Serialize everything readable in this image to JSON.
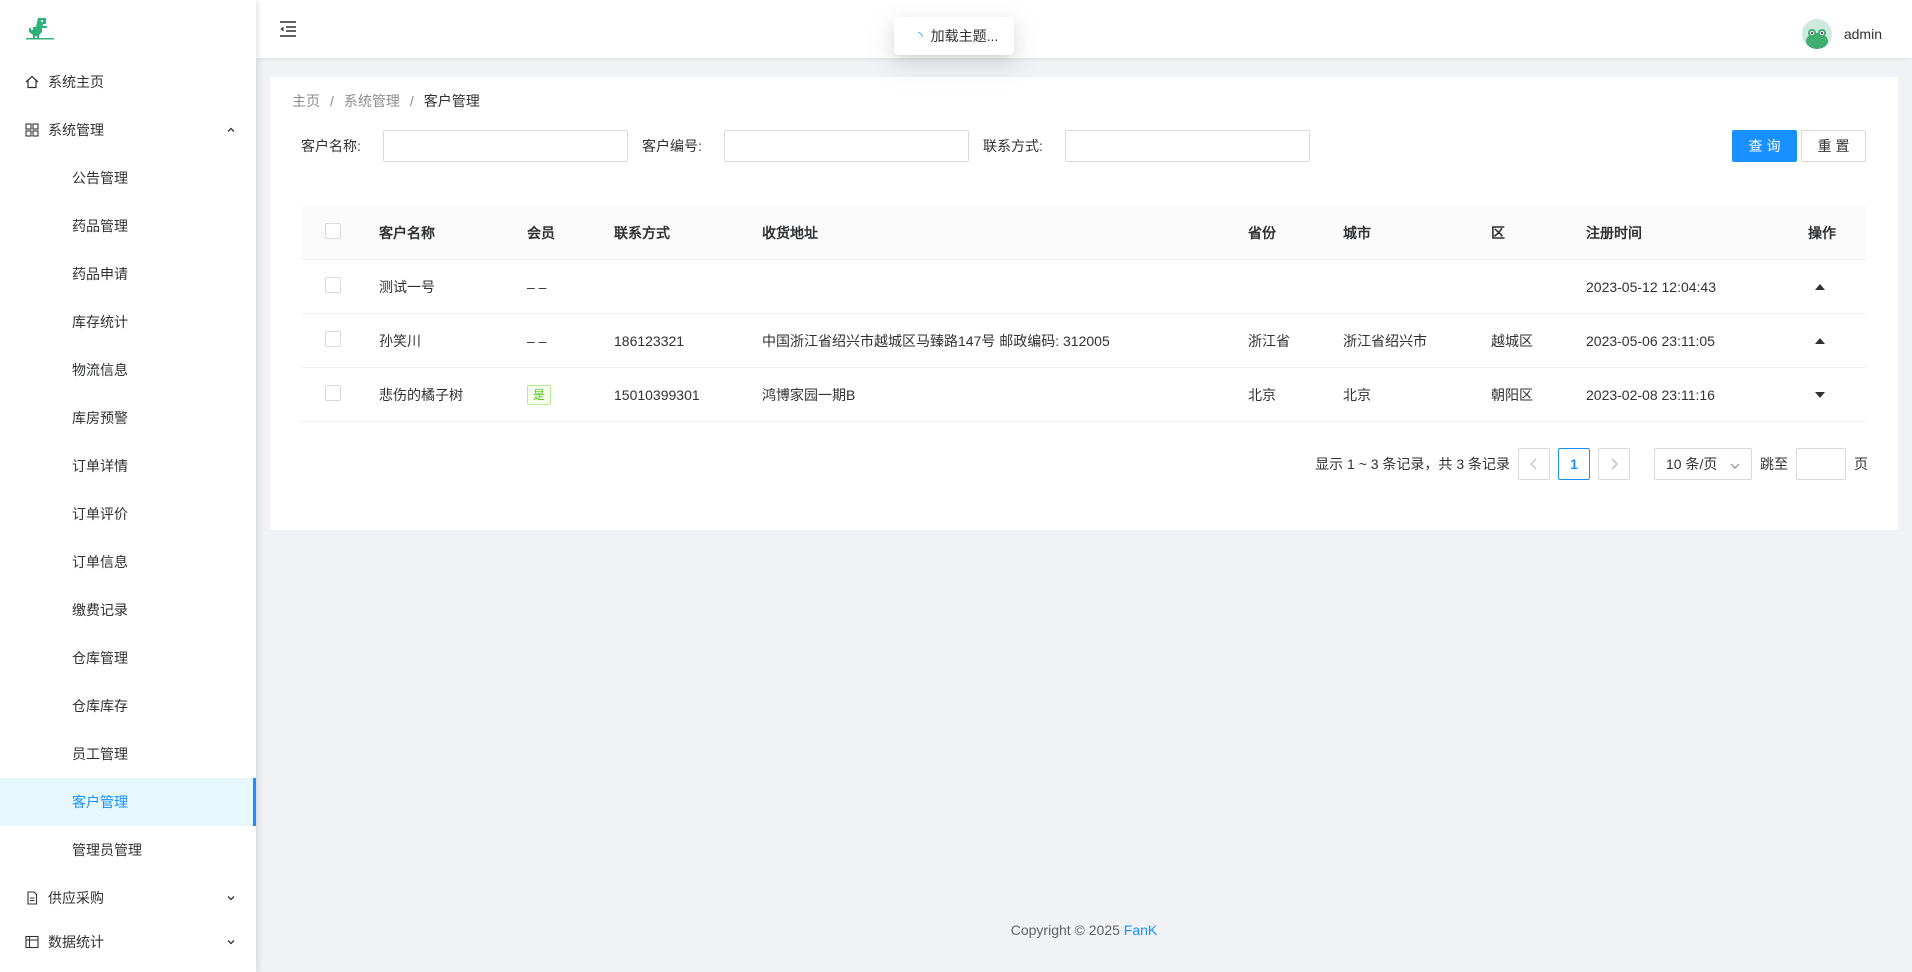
{
  "sidebar": {
    "items": [
      {
        "label": "系统主页"
      },
      {
        "label": "系统管理"
      },
      {
        "label": "供应采购"
      },
      {
        "label": "数据统计"
      }
    ],
    "sub_items": [
      {
        "label": "公告管理"
      },
      {
        "label": "药品管理"
      },
      {
        "label": "药品申请"
      },
      {
        "label": "库存统计"
      },
      {
        "label": "物流信息"
      },
      {
        "label": "库房预警"
      },
      {
        "label": "订单详情"
      },
      {
        "label": "订单评价"
      },
      {
        "label": "订单信息"
      },
      {
        "label": "缴费记录"
      },
      {
        "label": "仓库管理"
      },
      {
        "label": "仓库库存"
      },
      {
        "label": "员工管理"
      },
      {
        "label": "客户管理"
      },
      {
        "label": "管理员管理"
      }
    ]
  },
  "header": {
    "loading_text": "加载主题...",
    "user_name": "admin"
  },
  "breadcrumb": [
    "主页",
    "系统管理",
    "客户管理"
  ],
  "search": {
    "name_label": "客户名称:",
    "code_label": "客户编号:",
    "contact_label": "联系方式:",
    "query_button": "查询",
    "reset_button": "重置"
  },
  "table": {
    "headers": [
      "客户名称",
      "会员",
      "联系方式",
      "收货地址",
      "省份",
      "城市",
      "区",
      "注册时间",
      "操作"
    ],
    "rows": [
      {
        "name": "测试一号",
        "member": "– –",
        "phone": "",
        "address": "",
        "province": "",
        "city": "",
        "district": "",
        "time": "2023-05-12 12:04:43",
        "op": "up"
      },
      {
        "name": "孙笑川",
        "member": "– –",
        "phone": "186123321",
        "address": "中国浙江省绍兴市越城区马臻路147号 邮政编码: 312005",
        "province": "浙江省",
        "city": "浙江省绍兴市",
        "district": "越城区",
        "time": "2023-05-06 23:11:05",
        "op": "up"
      },
      {
        "name": "悲伤的橘子树",
        "member": "是",
        "phone": "15010399301",
        "address": "鸿博家园一期B",
        "province": "北京",
        "city": "北京",
        "district": "朝阳区",
        "time": "2023-02-08 23:11:16",
        "op": "down"
      }
    ]
  },
  "pagination": {
    "total_text": "显示 1 ~ 3 条记录，共 3 条记录",
    "current_page": "1",
    "page_size": "10 条/页",
    "jump_prefix": "跳至",
    "jump_suffix": "页"
  },
  "footer": {
    "copyright": "Copyright © 2025 ",
    "brand": "FanK"
  },
  "colors": {
    "primary": "#1890ff",
    "success": "#52c41a"
  }
}
